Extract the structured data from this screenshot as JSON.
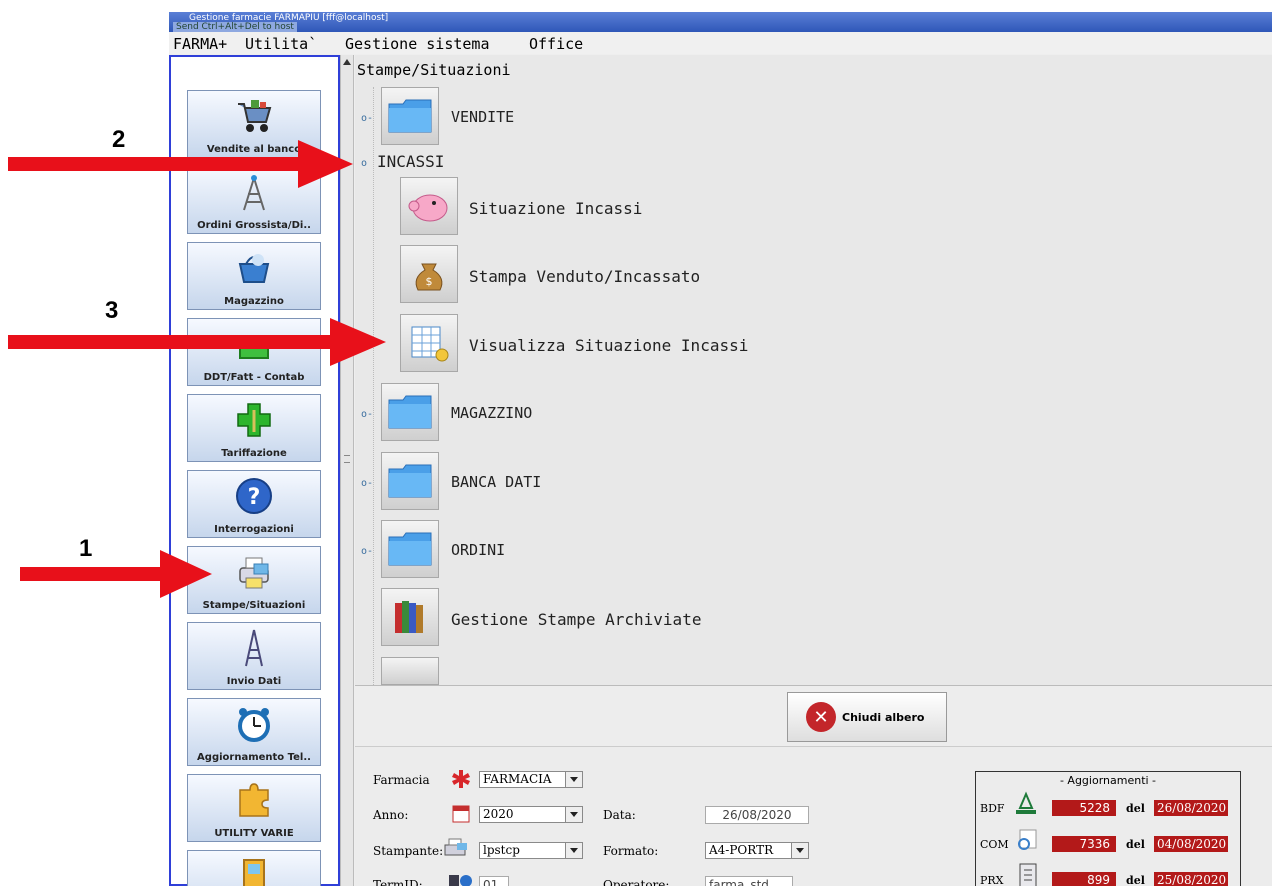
{
  "window": {
    "title": "Gestione farmacie FARMAPIU [fff@localhost]",
    "hint": "Send Ctrl+Alt+Del to host"
  },
  "menu": [
    "FARMA+",
    "Utilita`",
    "Gestione sistema",
    "Office"
  ],
  "sidebar": {
    "items": [
      {
        "label": "Vendite al banco",
        "icon": "shopping-cart-icon"
      },
      {
        "label": "Ordini Grossista/Di..",
        "icon": "antenna-tower-icon"
      },
      {
        "label": "Magazzino",
        "icon": "basket-icon"
      },
      {
        "label": "DDT/Fatt - Contab",
        "icon": "folder-icon"
      },
      {
        "label": "Tariffazione",
        "icon": "pharmacy-cross-icon"
      },
      {
        "label": "Interrogazioni",
        "icon": "question-icon"
      },
      {
        "label": "Stampe/Situazioni",
        "icon": "printer-icon"
      },
      {
        "label": "Invio Dati",
        "icon": "eiffel-tower-icon"
      },
      {
        "label": "Aggiornamento Tel..",
        "icon": "alarm-clock-icon"
      },
      {
        "label": "UTILITY VARIE",
        "icon": "puzzle-icon"
      },
      {
        "label": "",
        "icon": "door-icon"
      }
    ]
  },
  "tree": {
    "root": "Stampe/Situazioni",
    "nodes": {
      "vendite": "VENDITE",
      "incassi": "INCASSI",
      "situazione_incassi": "Situazione Incassi",
      "stampa_venduto": "Stampa Venduto/Incassato",
      "visualizza": "Visualizza Situazione Incassi",
      "magazzino": "MAGAZZINO",
      "banca_dati": "BANCA DATI",
      "ordini": "ORDINI",
      "archiviate": "Gestione Stampe Archiviate"
    }
  },
  "close_button": "Chiudi albero",
  "form": {
    "farmacia_label": "Farmacia",
    "farmacia_value": "FARMACIA",
    "anno_label": "Anno:",
    "anno_value": "2020",
    "data_label": "Data:",
    "data_value": "26/08/2020",
    "stampante_label": "Stampante:",
    "stampante_value": "lpstcp",
    "formato_label": "Formato:",
    "formato_value": "A4-PORTR",
    "termid_label": "TermID:",
    "termid_value": "01",
    "operatore_label": "Operatore:",
    "operatore_value": "farma_std"
  },
  "updates": {
    "title": "- Aggiornamenti -",
    "del": "del",
    "rows": [
      {
        "code": "BDF",
        "count": "5228",
        "date": "26/08/2020"
      },
      {
        "code": "COM",
        "count": "7336",
        "date": "04/08/2020"
      },
      {
        "code": "PRX",
        "count": "899",
        "date": "25/08/2020"
      }
    ]
  },
  "annotations": {
    "a1": "1",
    "a2": "2",
    "a3": "3"
  },
  "colors": {
    "arrow": "#e8101a",
    "sidebar_border": "#2f3fd8",
    "counter_bg": "#b31919"
  }
}
